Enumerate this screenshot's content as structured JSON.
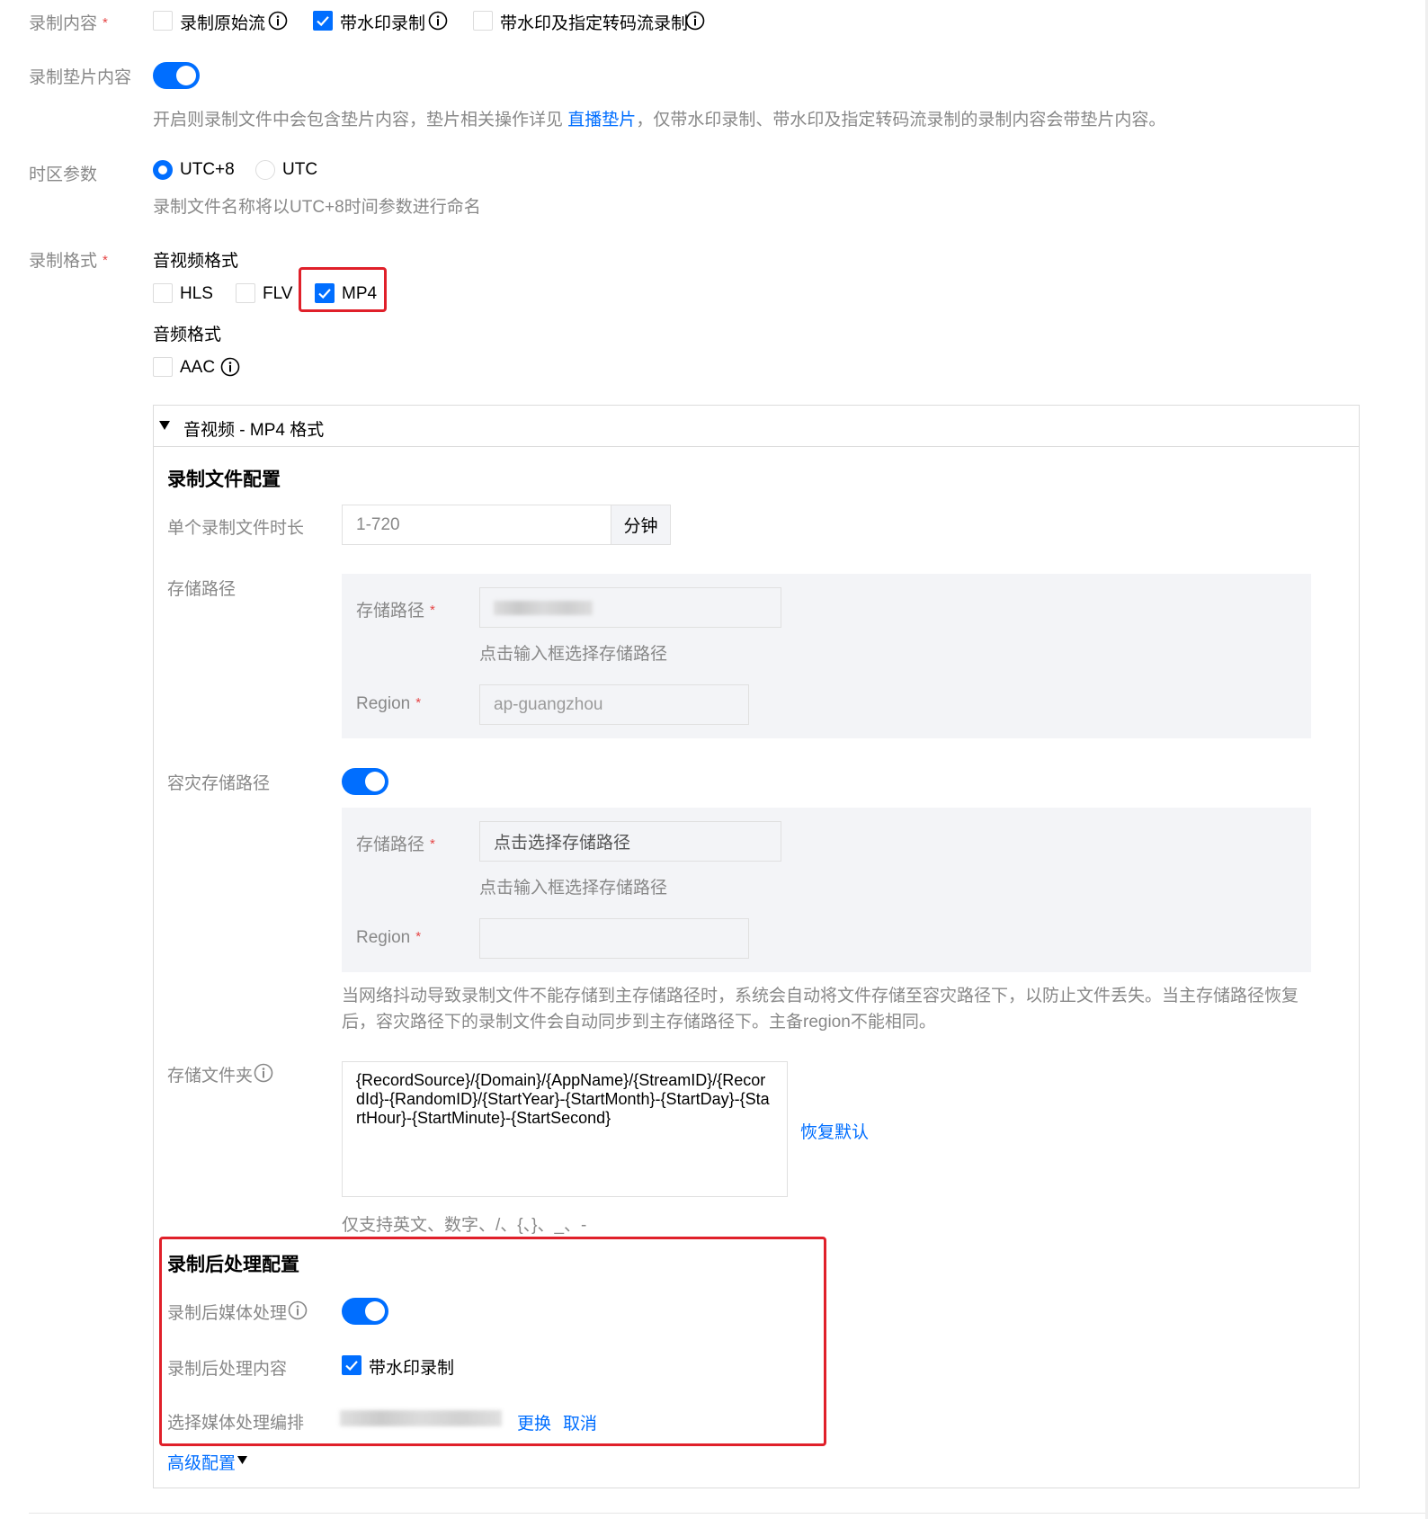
{
  "record_content": {
    "label": "录制内容",
    "options": [
      {
        "label": "录制原始流",
        "checked": false
      },
      {
        "label": "带水印录制",
        "checked": true
      },
      {
        "label": "带水印及指定转码流录制",
        "checked": false
      }
    ]
  },
  "record_slate": {
    "label": "录制垫片内容",
    "enabled": true,
    "help_prefix": "开启则录制文件中会包含垫片内容，垫片相关操作详见",
    "help_link": "直播垫片",
    "help_suffix": "，仅带水印录制、带水印及指定转码流录制的录制内容会带垫片内容。"
  },
  "timezone": {
    "label": "时区参数",
    "options": [
      {
        "label": "UTC+8",
        "selected": true
      },
      {
        "label": "UTC",
        "selected": false
      }
    ],
    "help": "录制文件名称将以UTC+8时间参数进行命名"
  },
  "record_format": {
    "label": "录制格式",
    "av_title": "音视频格式",
    "av_options": [
      {
        "label": "HLS",
        "checked": false
      },
      {
        "label": "FLV",
        "checked": false
      },
      {
        "label": "MP4",
        "checked": true
      }
    ],
    "audio_title": "音频格式",
    "audio_options": [
      {
        "label": "AAC",
        "checked": false
      }
    ]
  },
  "panel": {
    "header": "音视频 - MP4 格式",
    "file_config": {
      "title": "录制文件配置",
      "duration_label": "单个录制文件时长",
      "duration_placeholder": "1-720",
      "duration_unit": "分钟",
      "storage_label": "存储路径",
      "storage_path_label": "存储路径",
      "storage_path_hint": "点击输入框选择存储路径",
      "region_label": "Region",
      "region_value": "ap-guangzhou",
      "dr_label": "容灾存储路径",
      "dr_enabled": true,
      "dr_path_label": "存储路径",
      "dr_path_placeholder": "点击选择存储路径",
      "dr_path_hint": "点击输入框选择存储路径",
      "dr_region_label": "Region",
      "dr_help": "当网络抖动导致录制文件不能存储到主存储路径时，系统会自动将文件存储至容灾路径下，以防止文件丢失。当主存储路径恢复后，容灾路径下的录制文件会自动同步到主存储路径下。主备region不能相同。",
      "folder_label": "存储文件夹",
      "folder_value": "{RecordSource}/{Domain}/{AppName}/{StreamID}/{RecordId}-{RandomID}/{StartYear}-{StartMonth}-{StartDay}-{StartHour}-{StartMinute}-{StartSecond}",
      "folder_reset": "恢复默认",
      "folder_help": "仅支持英文、数字、/、{、}、_、-"
    },
    "post_config": {
      "title": "录制后处理配置",
      "media_label": "录制后媒体处理",
      "media_enabled": true,
      "content_label": "录制后处理内容",
      "content_option": "带水印录制",
      "content_checked": true,
      "workflow_label": "选择媒体处理编排",
      "change_link": "更换",
      "cancel_link": "取消"
    },
    "advanced": "高级配置"
  },
  "colors": {
    "accent": "#006eff",
    "highlight": "#e0202a",
    "required": "#e54545"
  }
}
